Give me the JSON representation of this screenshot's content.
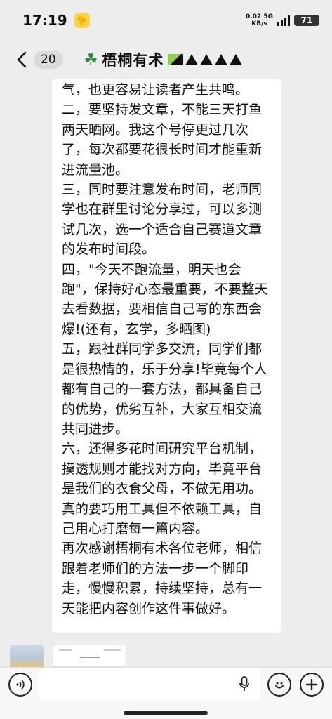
{
  "status_bar": {
    "time": "17:19",
    "network_speed": "0.02",
    "network_unit": "KB/s",
    "network_type": "5G",
    "battery": "71"
  },
  "header": {
    "back_count": "20",
    "title": "梧桐有术"
  },
  "message": {
    "text": "气，也更容易让读者产生共鸣。\n二，要坚持发文章，不能三天打鱼两天晒网。我这个号停更过几次了，每次都要花很长时间才能重新进流量池。\n三，同时要注意发布时间，老师同学也在群里讨论分享过，可以多测试几次，选一个适合自己赛道文章的发布时间段。\n四，\"今天不跑流量，明天也会跑\"，保持好心态最重要，不要整天去看数据，要相信自己写的东西会爆!(还有，玄学，多晒图)\n五，跟社群同学多交流，同学们都是很热情的，乐于分享!毕竟每个人都有自己的一套方法，都具备自己的优势，优劣互补，大家互相交流共同进步。\n六，还得多花时间研究平台机制，摸透规则才能找对方向，毕竟平台是我们的衣食父母，不做无用功。真的要巧用工具但不依赖工具，自己用心打磨每一篇内容。\n再次感谢梧桐有术各位老师，相信跟着老师们的方法一步一个脚印走，慢慢积累，持续坚持，总有一天能把内容创作这件事做好。"
  },
  "icons": {
    "back": "chevron-left-icon",
    "voice": "voice-icon",
    "mic": "microphone-icon",
    "emoji": "emoji-icon",
    "plus": "plus-icon"
  }
}
